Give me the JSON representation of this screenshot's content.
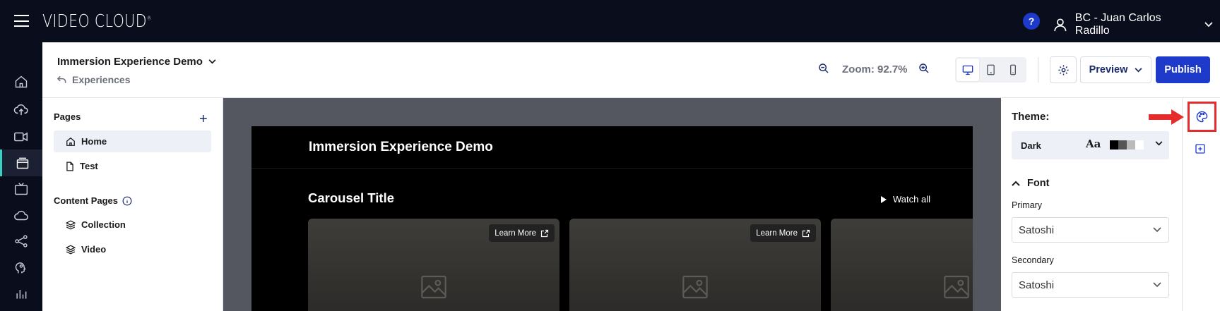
{
  "app": {
    "brand": "VIDEO CLOUD",
    "help_label": "?",
    "user_name": "BC - Juan Carlos Radillo"
  },
  "header": {
    "experience_title": "Immersion Experience Demo",
    "back_label": "Experiences",
    "zoom_label": "Zoom: 92.7%",
    "preview_label": "Preview",
    "publish_label": "Publish",
    "active_device": "desktop"
  },
  "pages_panel": {
    "pages_title": "Pages",
    "add_label": "+",
    "pages": [
      {
        "label": "Home",
        "icon": "home-icon"
      },
      {
        "label": "Test",
        "icon": "file-icon"
      }
    ],
    "content_pages_title": "Content Pages",
    "content_pages": [
      {
        "label": "Collection",
        "icon": "layers-icon"
      },
      {
        "label": "Video",
        "icon": "layers-icon"
      }
    ]
  },
  "canvas": {
    "site_title": "Immersion Experience Demo",
    "carousel_title": "Carousel Title",
    "watch_all_label": "Watch all",
    "cards": [
      {
        "learn_more_label": "Learn More"
      },
      {
        "learn_more_label": "Learn More"
      },
      {
        "learn_more_label": ""
      }
    ]
  },
  "theme_panel": {
    "theme_label": "Theme:",
    "theme_name": "Dark",
    "type_sample": "Aa",
    "swatch_colors": [
      "#000000",
      "#555555",
      "#bbbbbb",
      "#ffffff"
    ],
    "font_section": "Font",
    "primary_label": "Primary",
    "primary_value": "Satoshi",
    "secondary_label": "Secondary",
    "secondary_value": "Satoshi"
  },
  "colors": {
    "topbar": "#0a0d1c",
    "accent": "#1d3acb",
    "highlight": "#e52b2b",
    "nav_active": "#3ad0c4"
  }
}
